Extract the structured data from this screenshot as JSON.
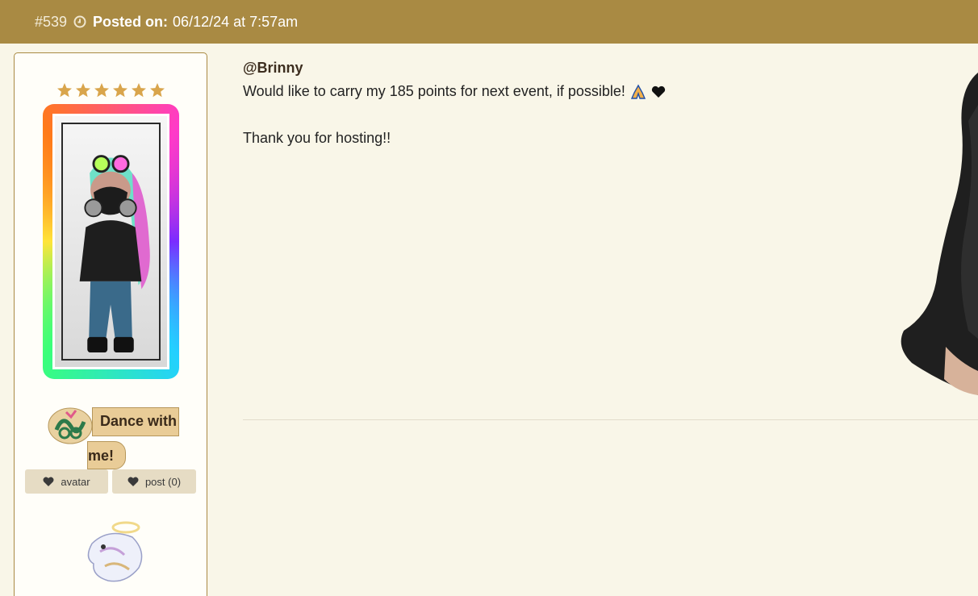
{
  "header": {
    "post_number": "#539",
    "posted_label": "Posted on:",
    "posted_date": "06/12/24 at 7:57am",
    "icon": "clock-icon"
  },
  "sidebar": {
    "rating_stars": 6,
    "badge": {
      "label_line1": "Dance with",
      "label_line2": "me!",
      "icon": "dance-badge-icon"
    },
    "like_avatar_label": "avatar",
    "like_post_label": "post (0)",
    "pet_icon": "angel-pet-icon"
  },
  "post": {
    "mention": "@Brinny",
    "line1": "Would like to carry my 185 points for next event, if possible!",
    "line2": "Thank you for hosting!!"
  },
  "colors": {
    "header_bg": "#a98a43",
    "page_bg": "#f9f6e8",
    "star": "#d9a54c",
    "badge_bg": "#e9cc97",
    "button_bg": "#e6dcc4"
  }
}
